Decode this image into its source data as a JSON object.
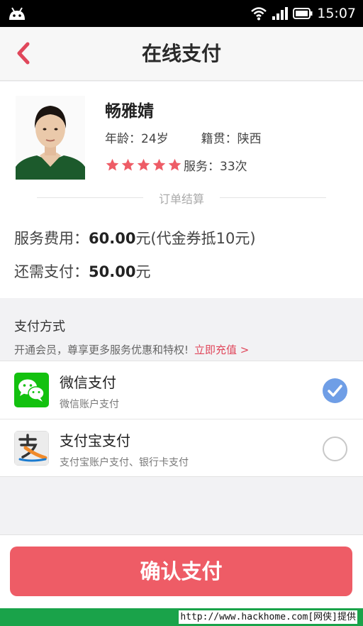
{
  "statusbar": {
    "time": "15:07"
  },
  "nav": {
    "title": "在线支付"
  },
  "profile": {
    "name": "畅雅婧",
    "age": "年龄：24岁",
    "origin": "籍贯：陕西",
    "stars": 5,
    "service": "服务：33次"
  },
  "divider": {
    "label": "订单结算"
  },
  "fees": {
    "service_fee_label": "服务费用：",
    "service_fee_amount": "60.00",
    "service_fee_suffix": "元(代金券抵10元)",
    "remaining_label": "还需支付：",
    "remaining_amount": "50.00",
    "remaining_suffix": "元"
  },
  "payment": {
    "title": "支付方式",
    "promo": "开通会员，尊享更多服务优惠和特权!",
    "recharge_link": "立即充值 >",
    "options": [
      {
        "name": "微信支付",
        "desc": "微信账户支付",
        "selected": true,
        "icon": "wechat-icon"
      },
      {
        "name": "支付宝支付",
        "desc": "支付宝账户支付、银行卡支付",
        "selected": false,
        "icon": "alipay-icon"
      }
    ]
  },
  "confirm_label": "确认支付",
  "watermark": "http://www.hackhome.com[网侠]提供",
  "colors": {
    "accent": "#ee5c66",
    "selected": "#6f9ee6",
    "wechat": "#13c10f"
  }
}
